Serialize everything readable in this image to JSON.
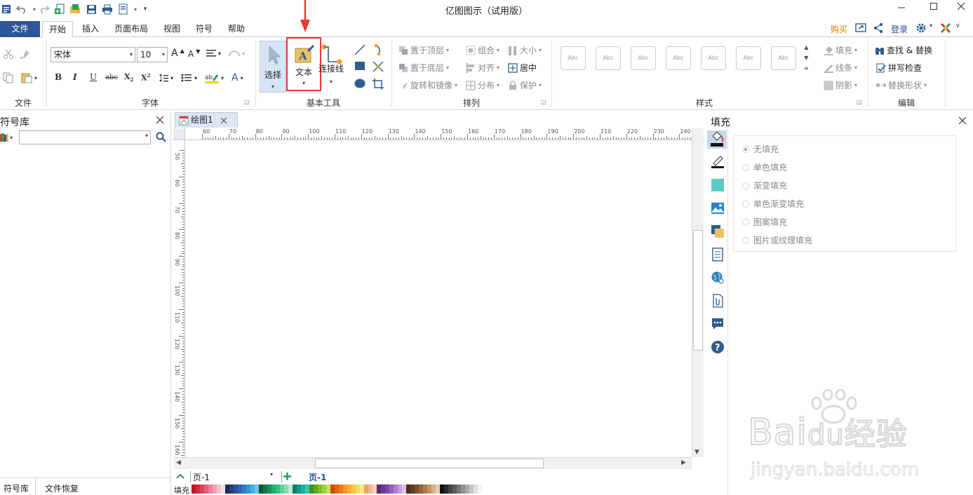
{
  "app": {
    "title": "亿图图示（试用版）"
  },
  "menu": {
    "file": "文件",
    "tabs": [
      "开始",
      "插入",
      "页面布局",
      "视图",
      "符号",
      "帮助"
    ],
    "buy": "购买",
    "login": "登录"
  },
  "ribbon": {
    "groups": {
      "file": "文件",
      "font": "字体",
      "basic_tools": "基本工具",
      "arrange": "排列",
      "style": "样式",
      "edit": "编辑"
    },
    "font_name": "宋体",
    "font_size": "10",
    "tools": {
      "select": "选择",
      "text": "文本",
      "connector": "连接线"
    },
    "arrange": {
      "bring_front": "置于顶层",
      "send_back": "置于底层",
      "rotate": "旋转和镜像",
      "group": "组合",
      "align": "对齐",
      "distribute": "分布",
      "size": "大小",
      "center": "居中",
      "protect": "保护"
    },
    "style_sample": "Abc",
    "style_props": {
      "fill": "填充",
      "line": "线条",
      "shadow": "阴影"
    },
    "edit": {
      "find_replace": "查找 & 替换",
      "spell_check": "拼写检查",
      "replace_shape": "替换形状"
    }
  },
  "left_panel": {
    "title": "符号库",
    "tabs": [
      "符号库",
      "文件恢复"
    ]
  },
  "document": {
    "tab": "绘图1",
    "ruler_h": [
      "60",
      "70",
      "80",
      "90",
      "100",
      "110",
      "120",
      "130",
      "140",
      "150",
      "160",
      "170",
      "180",
      "190",
      "200",
      "210",
      "220",
      "230",
      "240"
    ],
    "ruler_v": [
      "50",
      "60",
      "70",
      "80",
      "90",
      "100",
      "110",
      "120",
      "130",
      "140",
      "150",
      "160"
    ]
  },
  "pagebar": {
    "page_select": "页-1",
    "page_tab": "页-1",
    "fill_label": "填充"
  },
  "fill_panel": {
    "title": "填充",
    "options": [
      "无填充",
      "单色填充",
      "渐变填充",
      "单色渐变填充",
      "图案填充",
      "图片或纹理填充"
    ],
    "selected": "无填充"
  },
  "watermark": {
    "brand": "Bai",
    "brand2": "du",
    "cn": "经验",
    "url": "jingyan.baidu.com"
  },
  "colors": {
    "accent": "#2b579a",
    "highlight": "#e53935",
    "buy": "#e07a00"
  },
  "palette": [
    "#c0161e",
    "#d22a3a",
    "#e0405a",
    "#e8607a",
    "#ee8098",
    "#f2a0b2",
    "#f5bfca",
    "#f8dce2",
    "#1e2d5a",
    "#253e7a",
    "#2d5096",
    "#2e66b4",
    "#2d7ec8",
    "#3196d8",
    "#46aee2",
    "#6ac4ec",
    "#0d5a3a",
    "#11774a",
    "#17925a",
    "#1fae6e",
    "#2ec482",
    "#5fd29c",
    "#8ed8b4",
    "#c0e8d4",
    "#0f7a64",
    "#129a84",
    "#18b4a0",
    "#33c6b4",
    "#4a8e1a",
    "#62a822",
    "#7cc02c",
    "#a0d040",
    "#c8e060",
    "#d24a12",
    "#e06418",
    "#ea7c20",
    "#f29628",
    "#f6b030",
    "#f8c840",
    "#fadc58",
    "#fcea80",
    "#f2a070",
    "#f4b894",
    "#f8d0b8",
    "#5a2a7a",
    "#6c3692",
    "#8046a8",
    "#9860bc",
    "#b07ece",
    "#c8a0dc",
    "#dcc2ea",
    "#4a2e1e",
    "#603c26",
    "#7a4e30",
    "#94623c",
    "#ae7a4c",
    "#c49466",
    "#d8b08a",
    "#e8ccb0",
    "#101010",
    "#2a2a2a",
    "#444444",
    "#5e5e5e",
    "#787878",
    "#929292",
    "#acacac",
    "#c6c6c6",
    "#e0e0e0",
    "#f4f4f4"
  ]
}
